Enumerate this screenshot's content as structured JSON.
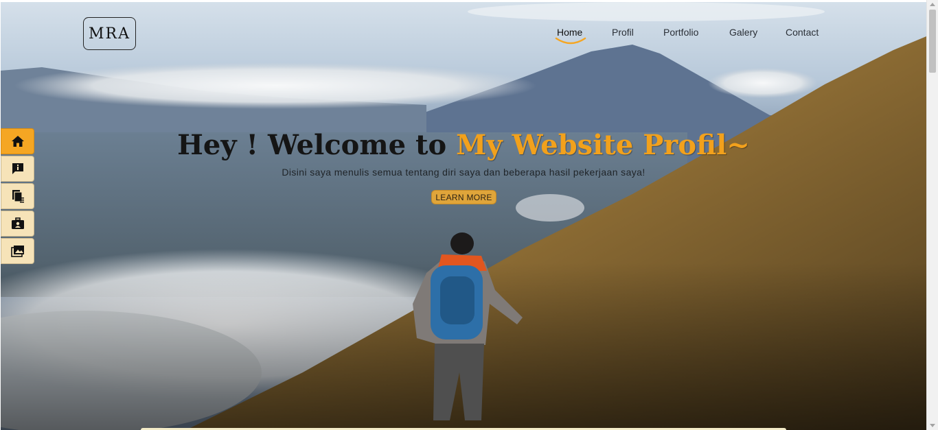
{
  "logo": {
    "text": "MRA"
  },
  "nav": {
    "items": [
      {
        "label": "Home",
        "active": true
      },
      {
        "label": "Profil"
      },
      {
        "label": "Portfolio"
      },
      {
        "label": "Galery"
      },
      {
        "label": "Contact"
      }
    ]
  },
  "sidebar": {
    "items": [
      {
        "icon": "home-icon",
        "active": true
      },
      {
        "icon": "info-icon"
      },
      {
        "icon": "documents-icon"
      },
      {
        "icon": "portfolio-icon"
      },
      {
        "icon": "gallery-icon"
      }
    ]
  },
  "hero": {
    "title_prefix": "Hey ! Welcome to ",
    "title_highlight": "My Website Profil~",
    "subtitle": "Disini saya menulis semua tentang diri saya dan beberapa hasil pekerjaan saya!",
    "cta_label": "LEARN MORE"
  },
  "colors": {
    "accent": "#f2a11c",
    "sidebar_bg": "#f6e3b8",
    "sidebar_active": "#f5a623"
  }
}
